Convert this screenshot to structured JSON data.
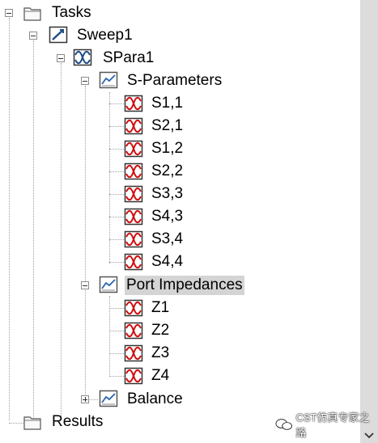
{
  "tree": {
    "tasks": {
      "label": "Tasks",
      "icon": "folder-icon"
    },
    "sweep": {
      "label": "Sweep1",
      "icon": "sweep-icon"
    },
    "spara": {
      "label": "SPara1",
      "icon": "spara-icon"
    },
    "sparams": {
      "label": "S-Parameters",
      "icon": "chart-folder-icon",
      "items": [
        "S1,1",
        "S2,1",
        "S1,2",
        "S2,2",
        "S3,3",
        "S4,3",
        "S3,4",
        "S4,4"
      ]
    },
    "port": {
      "label": "Port Impedances",
      "icon": "chart-folder-icon",
      "items": [
        "Z1",
        "Z2",
        "Z3",
        "Z4"
      ]
    },
    "balance": {
      "label": "Balance",
      "icon": "chart-folder-icon"
    },
    "results": {
      "label": "Results",
      "icon": "folder-icon"
    }
  },
  "watermark": {
    "text": "CST仿真专家之路"
  },
  "colors": {
    "selection": "#d4d4d4",
    "scrollbar": "#dcdcdc",
    "curve": "#d01010"
  }
}
